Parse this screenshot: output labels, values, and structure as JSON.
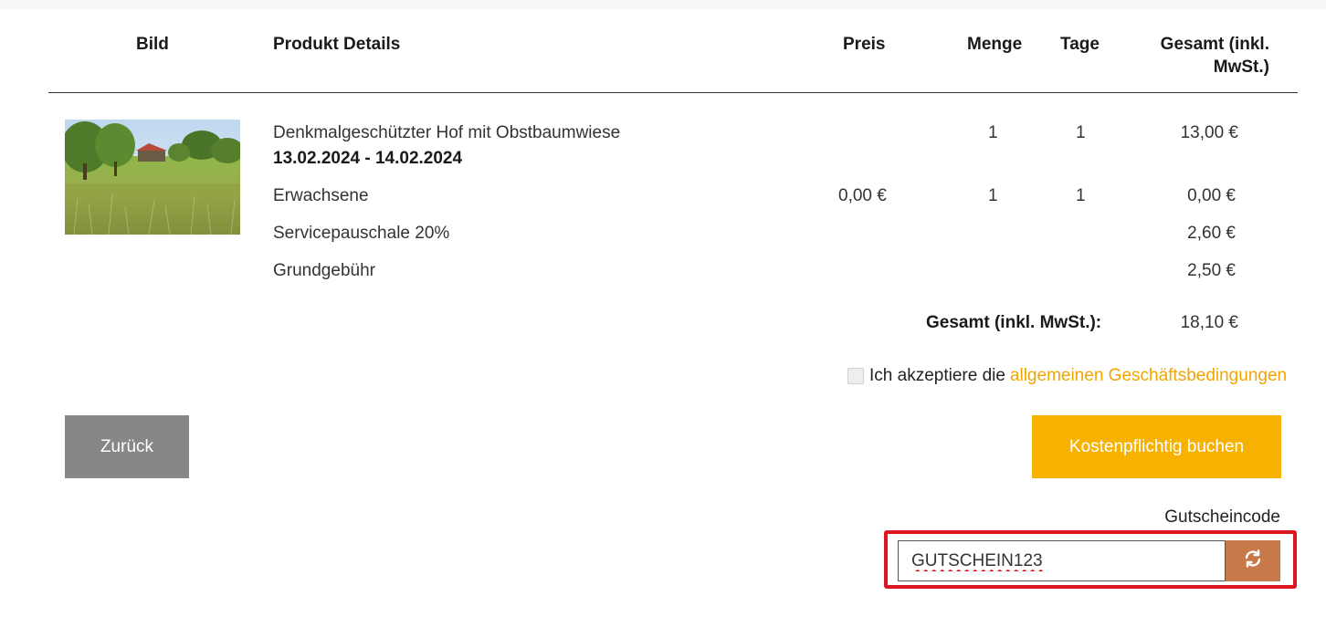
{
  "table": {
    "headers": {
      "bild": "Bild",
      "details": "Produkt Details",
      "preis": "Preis",
      "menge": "Menge",
      "tage": "Tage",
      "gesamt": "Gesamt (inkl. MwSt.)"
    }
  },
  "product": {
    "name": "Denkmalgeschützter Hof mit Obstbaumwiese",
    "dates": "13.02.2024 - 14.02.2024",
    "menge": "1",
    "tage": "1",
    "gesamt": "13,00 €"
  },
  "lines": [
    {
      "label": "Erwachsene",
      "preis": "0,00 €",
      "menge": "1",
      "tage": "1",
      "gesamt": "0,00 €"
    },
    {
      "label": "Servicepauschale 20%",
      "gesamt": "2,60 €"
    },
    {
      "label": "Grundgebühr",
      "gesamt": "2,50 €"
    }
  ],
  "total": {
    "label": "Gesamt (inkl. MwSt.):",
    "value": "18,10 €"
  },
  "terms": {
    "text": "Ich akzeptiere die",
    "link": "allgemeinen Geschäftsbedingungen",
    "checked": false
  },
  "buttons": {
    "back": "Zurück",
    "book": "Kostenpflichtig buchen"
  },
  "coupon": {
    "label": "Gutscheincode",
    "value": "GUTSCHEIN123",
    "button_icon": "refresh-icon"
  },
  "colors": {
    "accent": "#f7b100",
    "link": "#f0a500",
    "back_button": "#878787",
    "coupon_button": "#c8794a",
    "highlight": "#e0141e"
  }
}
